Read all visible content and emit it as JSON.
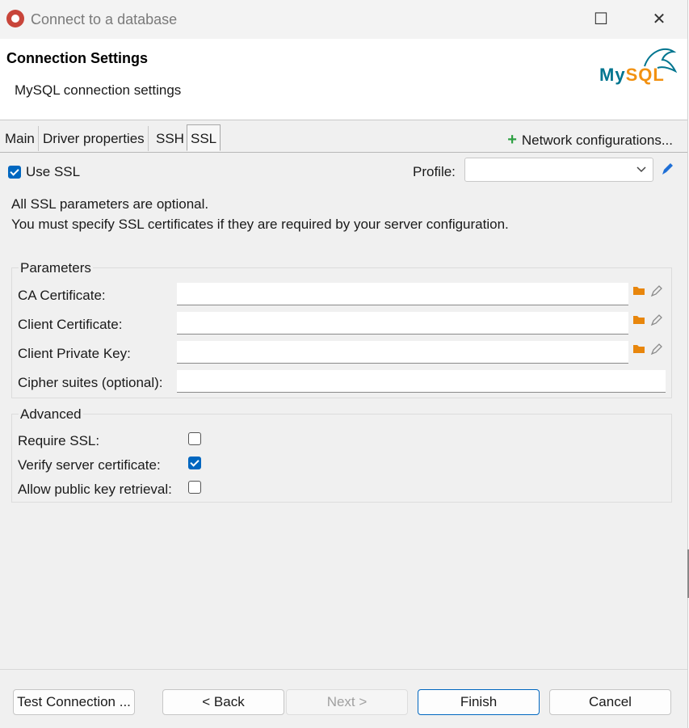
{
  "window": {
    "title": "Connect to a database",
    "maximize_glyph": "☐",
    "close_glyph": "✕"
  },
  "header": {
    "title": "Connection Settings",
    "subtitle": "MySQL connection settings",
    "logo_my": "My",
    "logo_sql": "SQL"
  },
  "tabs": [
    {
      "label": "Main"
    },
    {
      "label": "Driver properties"
    },
    {
      "label": "SSH"
    },
    {
      "label": "SSL",
      "active": true
    }
  ],
  "network_config": {
    "plus": "+",
    "label": "Network configurations..."
  },
  "ssl": {
    "use_ssl_label": "Use SSL",
    "use_ssl_checked": true,
    "profile_label": "Profile:",
    "profile_value": "",
    "info_line1": "All SSL parameters are optional.",
    "info_line2": "You must specify SSL certificates if they are required by your server configuration."
  },
  "parameters": {
    "title": "Parameters",
    "fields": [
      {
        "label": "CA Certificate:",
        "value": ""
      },
      {
        "label": "Client Certificate:",
        "value": ""
      },
      {
        "label": "Client Private Key:",
        "value": ""
      },
      {
        "label": "Cipher suites (optional):",
        "value": ""
      }
    ]
  },
  "advanced": {
    "title": "Advanced",
    "options": [
      {
        "label": "Require SSL:",
        "checked": false
      },
      {
        "label": "Verify server certificate:",
        "checked": true
      },
      {
        "label": "Allow public key retrieval:",
        "checked": false
      }
    ]
  },
  "buttons": {
    "test_connection": "Test Connection ...",
    "back": "< Back",
    "next": "Next >",
    "finish": "Finish",
    "cancel": "Cancel"
  },
  "colors": {
    "accent": "#0067c0",
    "mysql_blue": "#00758f",
    "mysql_orange": "#f29111",
    "plus_green": "#2ea043",
    "folder_orange": "#e8860c"
  }
}
